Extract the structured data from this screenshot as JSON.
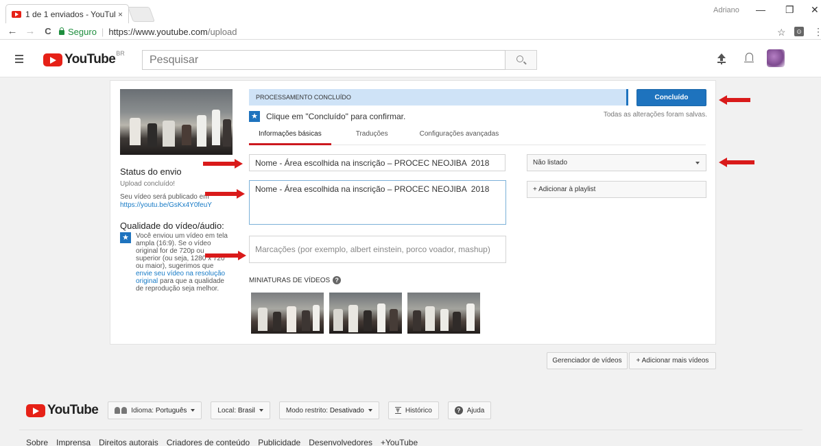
{
  "browser": {
    "tab_title": "1 de 1 enviados - YouTul",
    "tab_close": "×",
    "user": "Adriano",
    "minimize": "—",
    "maximize": "❐",
    "close": "✕",
    "back": "←",
    "forward": "→",
    "reload": "C",
    "secure_label": "Seguro",
    "url_host": "https://www.youtube.com",
    "url_path": "/upload",
    "bookmark": "☆",
    "extension": "⊙",
    "menu": "⋮"
  },
  "header": {
    "logo_text": "YouTube",
    "region": "BR",
    "search_placeholder": "Pesquisar"
  },
  "upload": {
    "status_heading": "Status do envio",
    "status_text": "Upload concluído!",
    "publish_text": "Seu vídeo será publicado em",
    "video_link": "https://youtu.be/GsKx4Y0feuY",
    "quality_heading": "Qualidade do vídeo/áudio:",
    "quality_text_1": "Você enviou um vídeo em tela ampla (16:9). Se o vídeo original for de 720p ou superior (ou seja, 1280 x 720 ou maior), sugerimos que ",
    "quality_link": "envie seu vídeo na resolução original",
    "quality_text_2": " para que a qualidade de reprodução seja melhor.",
    "processing": "Processamento concluído",
    "done_button": "Concluído",
    "confirm_text": "Clique em \"Concluído\" para confirmar.",
    "saved_text": "Todas as alterações foram salvas.",
    "tabs": [
      "Informações básicas",
      "Traduções",
      "Configurações avançadas"
    ],
    "title_value": "Nome - Área escolhida na inscrição – PROCEC NEOJIBA  2018",
    "description_value": "Nome - Área escolhida na inscrição – PROCEC NEOJIBA  2018",
    "tags_placeholder": "Marcações (por exemplo, albert einstein, porco voador, mashup)",
    "privacy_value": "Não listado",
    "playlist_button": "+ Adicionar à playlist",
    "thumbnails_heading": "Miniaturas de vídeos",
    "help_glyph": "?",
    "star_glyph": "★"
  },
  "actions": {
    "video_manager": "Gerenciador de vídeos",
    "add_more": "+ Adicionar mais vídeos"
  },
  "footer": {
    "logo_text": "YouTube",
    "language_label": "Idioma:",
    "language_value": "Português",
    "location_label": "Local:",
    "location_value": "Brasil",
    "restricted_label": "Modo restrito:",
    "restricted_value": "Desativado",
    "history": "Histórico",
    "help": "Ajuda",
    "help_glyph": "?",
    "links": [
      "Sobre",
      "Imprensa",
      "Direitos autorais",
      "Criadores de conteúdo",
      "Publicidade",
      "Desenvolvedores",
      "+YouTube"
    ]
  },
  "colors": {
    "accent_blue": "#1e73be",
    "youtube_red": "#e62117",
    "annotation_arrow": "#d91a1a",
    "progress_bg": "#cfe3f7"
  }
}
